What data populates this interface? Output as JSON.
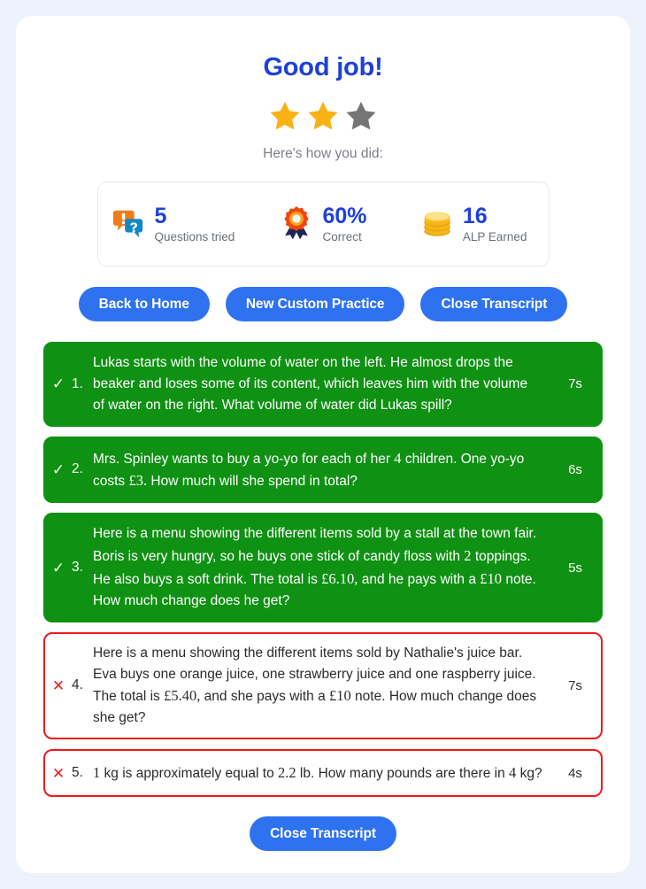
{
  "header": {
    "title": "Good job!",
    "subtitle": "Here's how you did:",
    "stars": [
      {
        "name": "star-1",
        "state": "filled",
        "color": "#f9b115"
      },
      {
        "name": "star-2",
        "state": "filled",
        "color": "#f9b115"
      },
      {
        "name": "star-3",
        "state": "empty",
        "color": "#757575"
      }
    ]
  },
  "stats": [
    {
      "icon": "question-bubbles-icon",
      "value": "5",
      "label": "Questions tried"
    },
    {
      "icon": "award-rosette-icon",
      "value": "60%",
      "label": "Correct"
    },
    {
      "icon": "coin-stack-icon",
      "value": "16",
      "label": "ALP Earned"
    }
  ],
  "actions": [
    {
      "name": "back-to-home-button",
      "label": "Back to Home"
    },
    {
      "name": "new-custom-practice-button",
      "label": "New Custom Practice"
    },
    {
      "name": "close-transcript-button-top",
      "label": "Close Transcript"
    }
  ],
  "transcript": [
    {
      "status": "correct",
      "mark": "✓",
      "number": "1.",
      "text": "Lukas starts with the volume of water on the left. He almost drops the beaker and loses some of its content, which leaves him with the volume of water on the right. What volume of water did Lukas spill?",
      "time": "7s"
    },
    {
      "status": "correct",
      "mark": "✓",
      "number": "2.",
      "text": "Mrs. Spinley wants to buy a yo-yo for each of her 4 children. One yo-yo costs £3. How much will she spend in total?",
      "time": "6s"
    },
    {
      "status": "correct",
      "mark": "✓",
      "number": "3.",
      "text": "Here is a menu showing the different items sold by a stall at the town fair. Boris is very hungry, so he buys one stick of candy floss with 2 toppings. He also buys a soft drink. The total is £6.10, and he pays with a £10 note. How much change does he get?",
      "time": "5s"
    },
    {
      "status": "incorrect",
      "mark": "✕",
      "number": "4.",
      "text": "Here is a menu showing the different items sold by Nathalie's juice bar. Eva buys one orange juice, one strawberry juice and one raspberry juice. The total is £5.40, and she pays with a £10 note. How much change does she get?",
      "time": "7s"
    },
    {
      "status": "incorrect",
      "mark": "✕",
      "number": "5.",
      "text": "1 kg is approximately equal to 2.2 lb. How many pounds are there in 4 kg?",
      "time": "4s"
    }
  ],
  "footer": {
    "close_transcript_label": "Close Transcript"
  },
  "colors": {
    "page_background": "#eef2fc",
    "card_background": "#ffffff",
    "title_blue": "#1e40d8",
    "button_blue": "#2f72f0",
    "correct_green": "#0f9113",
    "incorrect_red": "#f01a1a",
    "star_gold": "#f9b115",
    "star_gray": "#757575"
  }
}
